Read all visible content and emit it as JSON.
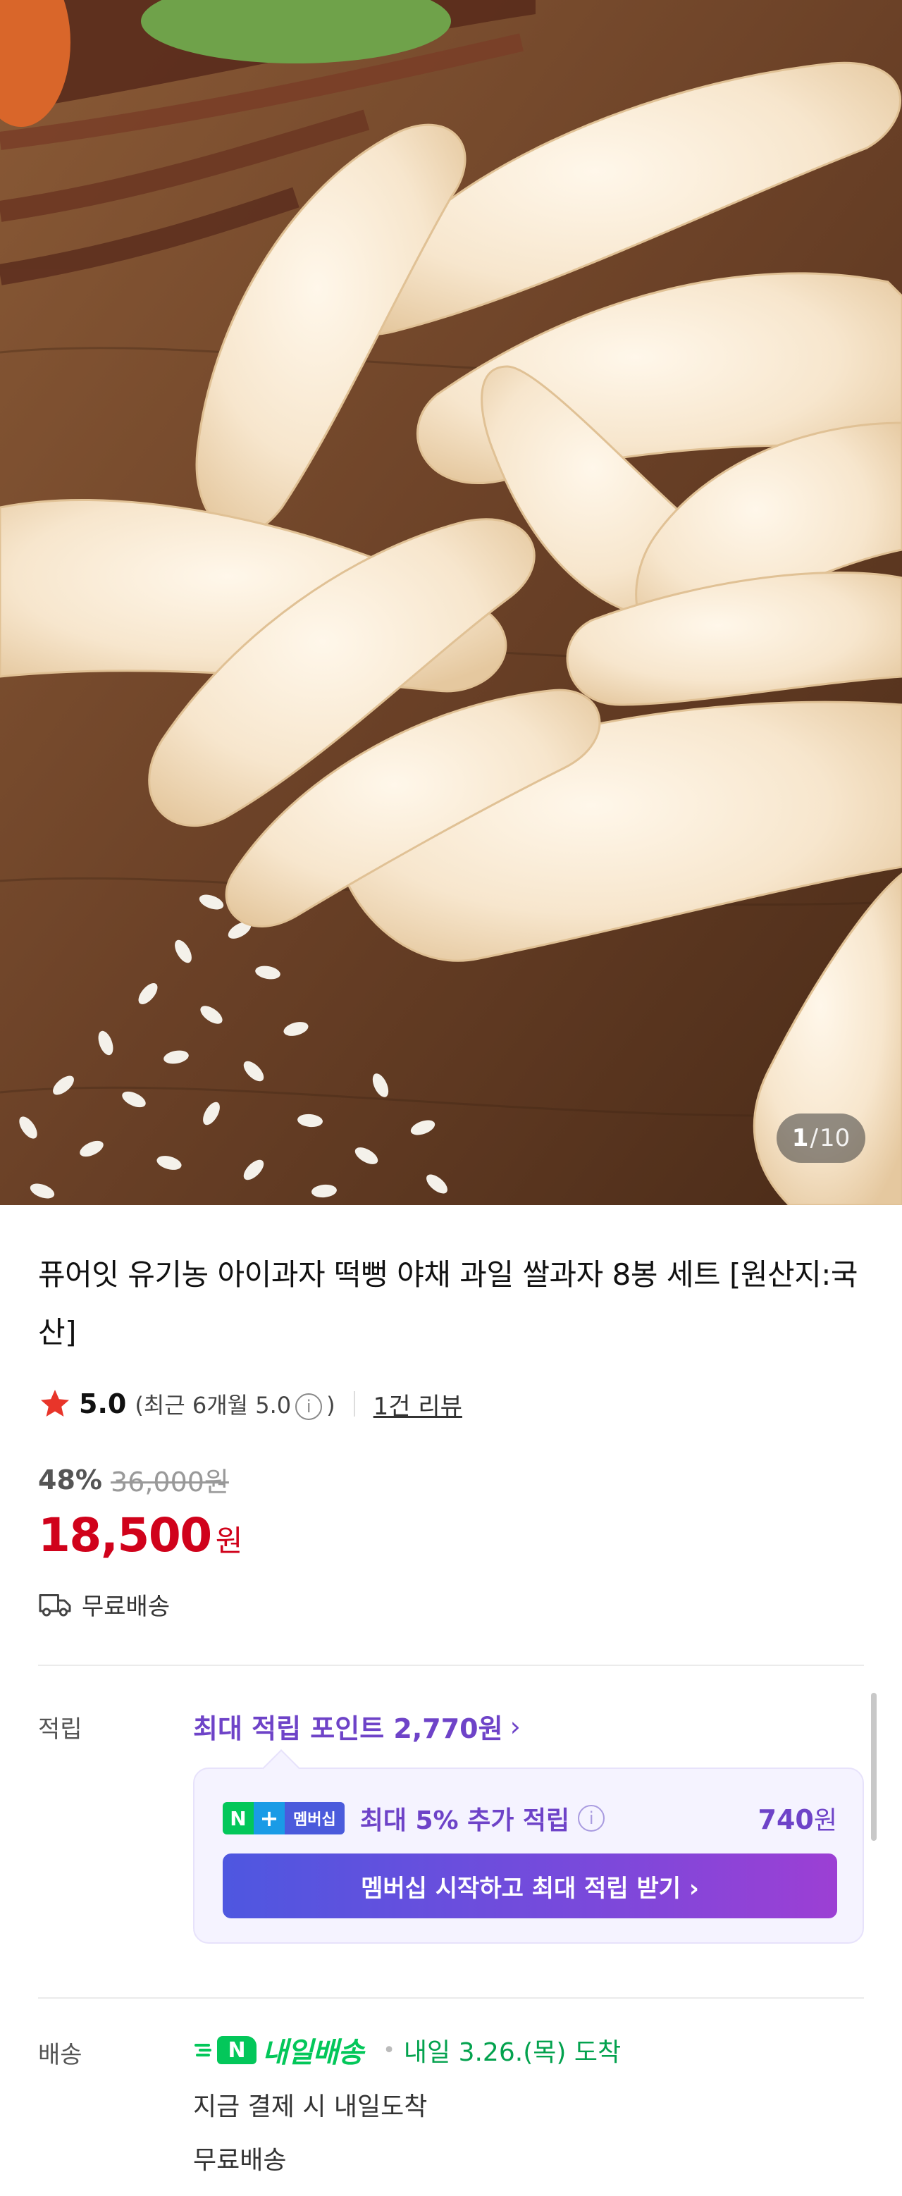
{
  "hero": {
    "counter_current": "1",
    "counter_separator": "/",
    "counter_total": "10"
  },
  "product": {
    "title": "퓨어잇 유기농 아이과자 떡뻥 야채 과일 쌀과자 8봉 세트 [원산지:국산]",
    "rating": "5.0",
    "rating_recent_prefix": "(최근 6개월 5.0",
    "rating_recent_suffix": ")",
    "info_glyph": "i",
    "review_link": "1건 리뷰",
    "discount_rate": "48%",
    "original_price": "36,000원",
    "price": "18,500",
    "price_unit": "원",
    "shipping": "무료배송"
  },
  "points": {
    "label": "적립",
    "headline": "최대 적립 포인트 2,770원",
    "chevron": "›",
    "badge_n": "N",
    "badge_plus": "+",
    "badge_text": "멤버십",
    "extra_text": "최대 5% 추가 적립",
    "extra_amount": "740",
    "extra_unit": "원",
    "cta": "멤버십 시작하고 최대 적립 받기 ›"
  },
  "delivery": {
    "label": "배송",
    "badge_n": "N",
    "badge_text": "내일배송",
    "dot": "•",
    "arrival": "내일 3.26.(목) 도착",
    "line1": "지금 결제 시 내일도착",
    "line2": "무료배송"
  },
  "colors": {
    "price_red": "#d0021b",
    "points_purple": "#6e43c8",
    "naver_green": "#03c75a"
  }
}
